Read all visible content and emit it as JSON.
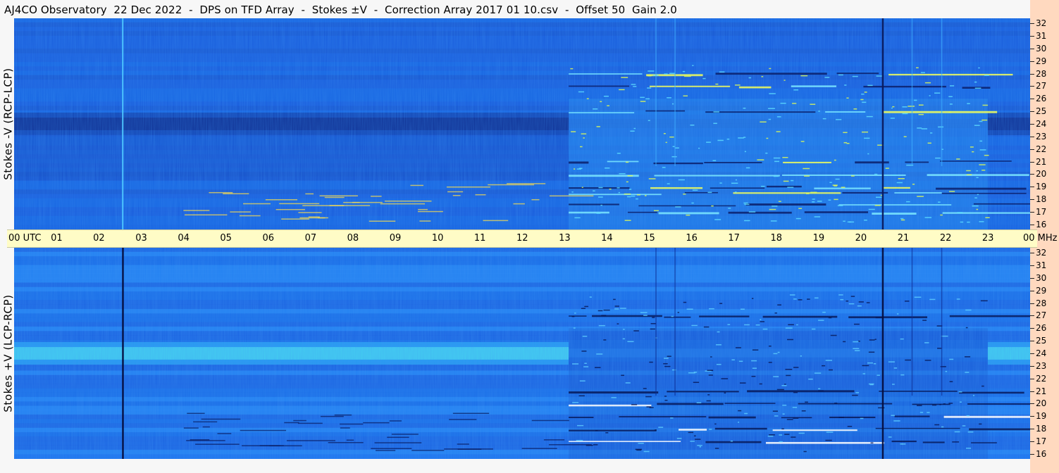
{
  "title": "AJ4CO Observatory  22 Dec 2022  -  DPS on TFD Array  -  Stokes ±V  -  Correction Array 2017 01 10.csv  -  Offset 50  Gain 2.0",
  "colors": {
    "low": "#0a1a6e",
    "mid": "#1a63e6",
    "high": "#3fb8ff",
    "hot": "#d7ff3c",
    "timebar": "#fffcc6",
    "strip": "#ffd9bf"
  },
  "chart_data": [
    {
      "type": "heatmap",
      "panel": "top",
      "ylabel": "Stokes -V  (RCP-LCP)",
      "x_range_hours_utc": [
        0,
        24
      ],
      "y_range_mhz": [
        16,
        32
      ],
      "yticks": [
        "32",
        "31",
        "30",
        "29",
        "28",
        "27",
        "26",
        "25",
        "24",
        "23",
        "22",
        "21",
        "20",
        "19",
        "18",
        "17",
        "16"
      ],
      "ytick_values": [
        32,
        31,
        30,
        29,
        28,
        27,
        26,
        25,
        24,
        23,
        22,
        21,
        20,
        19,
        18,
        17,
        16
      ],
      "colormap": [
        "#0a1a6e",
        "#1a63e6",
        "#3fb8ff",
        "#d7ff3c"
      ],
      "features": {
        "dark_band_mhz": [
          23.5,
          24.5
        ],
        "dark_band_hours": [
          [
            0,
            13.1
          ],
          [
            23,
            24
          ]
        ],
        "interference_active_hours": [
          13.1,
          23
        ],
        "bright_lines_mhz": [
          17,
          17.6,
          18.5,
          19,
          20,
          21,
          25,
          27,
          28
        ],
        "vertical_lines_hours": [
          2.55,
          20.5
        ]
      }
    },
    {
      "type": "heatmap",
      "panel": "bottom",
      "ylabel": "Stokes +V  (LCP-RCP)",
      "x_range_hours_utc": [
        0,
        24
      ],
      "y_range_mhz": [
        16,
        32
      ],
      "yticks": [
        "32",
        "31",
        "30",
        "29",
        "28",
        "27",
        "26",
        "25",
        "24",
        "23",
        "22",
        "21",
        "20",
        "19",
        "18",
        "17",
        "16"
      ],
      "ytick_values": [
        32,
        31,
        30,
        29,
        28,
        27,
        26,
        25,
        24,
        23,
        22,
        21,
        20,
        19,
        18,
        17,
        16
      ],
      "colormap": [
        "#0a1a6e",
        "#1a63e6",
        "#3fb8ff",
        "#d7ff3c"
      ],
      "features": {
        "bright_band_mhz": [
          23.5,
          24.5
        ],
        "bright_band_hours": [
          [
            0,
            13.1
          ],
          [
            23,
            24
          ]
        ],
        "interference_active_hours": [
          13.1,
          23
        ],
        "dark_lines_mhz": [
          17,
          18,
          19,
          20,
          21,
          27
        ],
        "vertical_lines_hours": [
          2.55,
          20.5
        ]
      }
    }
  ],
  "time_axis": {
    "labels": [
      "00  UTC",
      "01",
      "02",
      "03",
      "04",
      "05",
      "06",
      "07",
      "08",
      "09",
      "10",
      "11",
      "12",
      "13",
      "14",
      "15",
      "16",
      "17",
      "18",
      "19",
      "20",
      "21",
      "22",
      "23",
      "00 MHz"
    ],
    "hours": [
      0,
      1,
      2,
      3,
      4,
      5,
      6,
      7,
      8,
      9,
      10,
      11,
      12,
      13,
      14,
      15,
      16,
      17,
      18,
      19,
      20,
      21,
      22,
      23,
      24
    ]
  }
}
